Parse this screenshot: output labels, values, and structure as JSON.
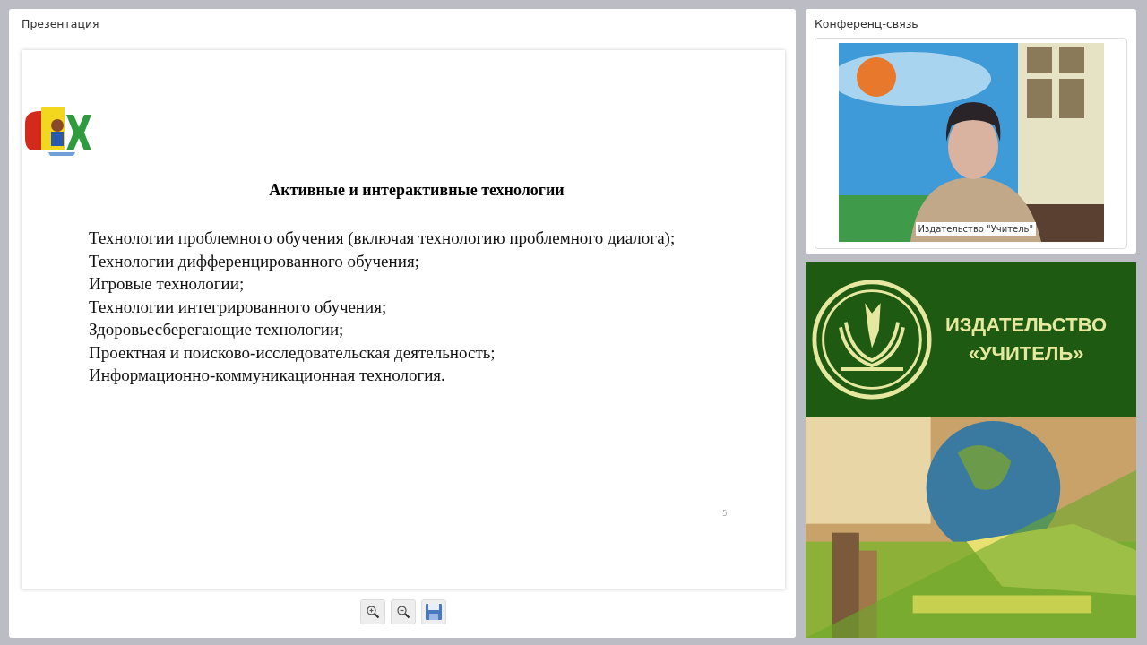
{
  "presentation": {
    "title": "Презентация",
    "slide": {
      "heading": "Активные и интерактивные технологии",
      "items": [
        "Технологии проблемного обучения (включая технологию проблемного диалога);",
        "Технологии дифференцированного обучения;",
        "Игровые технологии;",
        "Технологии интегрированного обучения;",
        "Здоровьесберегающие технологии;",
        "Проектная и поисково-исследовательская деятельность;",
        "Информационно-коммуникационная технология."
      ],
      "slide_number": "5"
    }
  },
  "conference": {
    "title": "Конференц-связь",
    "video_caption": "Издательство \"Учитель\""
  },
  "banner": {
    "lines": [
      "ИЗДАТЕЛЬСТВО",
      "«УЧИТЕЛЬ»"
    ]
  }
}
